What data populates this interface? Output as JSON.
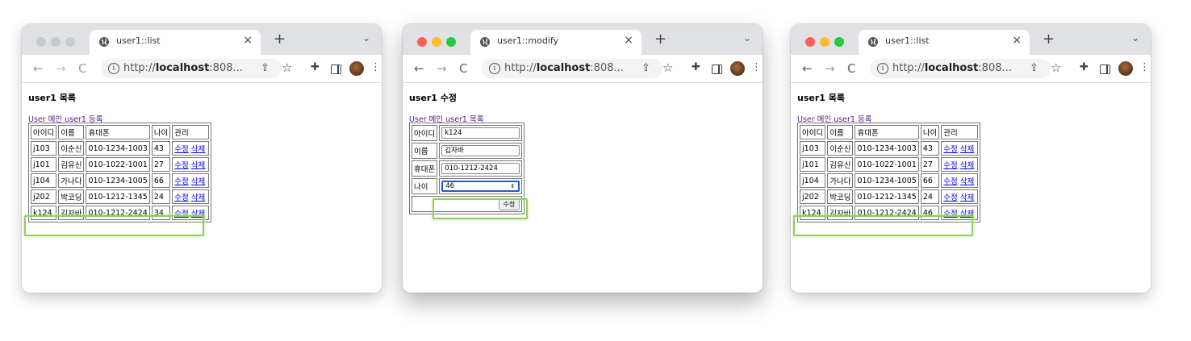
{
  "colors": {
    "red": "#ff5f57",
    "yellow": "#febc2e",
    "green": "#28c840",
    "inactive": "#c9cacc",
    "highlight": "#8ed160"
  },
  "icons": [
    "globe-icon",
    "close-icon",
    "plus-icon",
    "chevron-down-icon",
    "back-icon",
    "forward-icon",
    "reload-icon",
    "info-icon",
    "share-icon",
    "star-icon",
    "puzzle-icon",
    "sidepanel-icon",
    "avatar",
    "kebab-icon"
  ],
  "browser": {
    "url_prefix": "http://",
    "url_host": "localhost",
    "url_suffix": ":808...",
    "close": "×",
    "plus": "+",
    "chevron": "⌄",
    "back": "←",
    "forward": "→",
    "reload": "C",
    "info": "i",
    "share": "⇧",
    "star": "☆",
    "puzzle": "✚",
    "kebab": "⋮"
  },
  "list1": {
    "tab_title": "user1::list",
    "heading": "user1 목록",
    "link_main": "User 메인",
    "link_register": "user1 등록",
    "headers": {
      "id": "아이디",
      "name": "이름",
      "phone": "휴대폰",
      "age": "나이",
      "manage": "관리"
    },
    "edit": "수정",
    "delete": "삭제",
    "rows": [
      {
        "id": "j103",
        "name": "이순신",
        "phone": "010-1234-1003",
        "age": "43"
      },
      {
        "id": "j101",
        "name": "김유신",
        "phone": "010-1022-1001",
        "age": "27"
      },
      {
        "id": "j104",
        "name": "가나다",
        "phone": "010-1234-1005",
        "age": "66"
      },
      {
        "id": "j202",
        "name": "박코딩",
        "phone": "010-1212-1345",
        "age": "24"
      },
      {
        "id": "k124",
        "name": "김자바",
        "phone": "010-1212-2424",
        "age": "34"
      }
    ]
  },
  "modify": {
    "tab_title": "user1::modify",
    "heading": "user1 수정",
    "link_main": "User 메인",
    "link_list": "user1 목록",
    "labels": {
      "id": "아이디",
      "name": "이름",
      "phone": "휴대폰",
      "age": "나이"
    },
    "values": {
      "id": "k124",
      "name": "김자바",
      "phone": "010-1212-2424",
      "age": "46"
    },
    "submit": "수정",
    "spin": "⇕"
  },
  "list2": {
    "tab_title": "user1::list",
    "heading": "user1 목록",
    "link_main": "User 메인",
    "link_register": "user1 등록",
    "headers": {
      "id": "아이디",
      "name": "이름",
      "phone": "휴대폰",
      "age": "나이",
      "manage": "관리"
    },
    "edit": "수정",
    "delete": "삭제",
    "rows": [
      {
        "id": "j103",
        "name": "이순신",
        "phone": "010-1234-1003",
        "age": "43"
      },
      {
        "id": "j101",
        "name": "김유신",
        "phone": "010-1022-1001",
        "age": "27"
      },
      {
        "id": "j104",
        "name": "가나다",
        "phone": "010-1234-1005",
        "age": "66"
      },
      {
        "id": "j202",
        "name": "박코딩",
        "phone": "010-1212-1345",
        "age": "24"
      },
      {
        "id": "k124",
        "name": "김자바",
        "phone": "010-1212-2424",
        "age": "46"
      }
    ]
  }
}
